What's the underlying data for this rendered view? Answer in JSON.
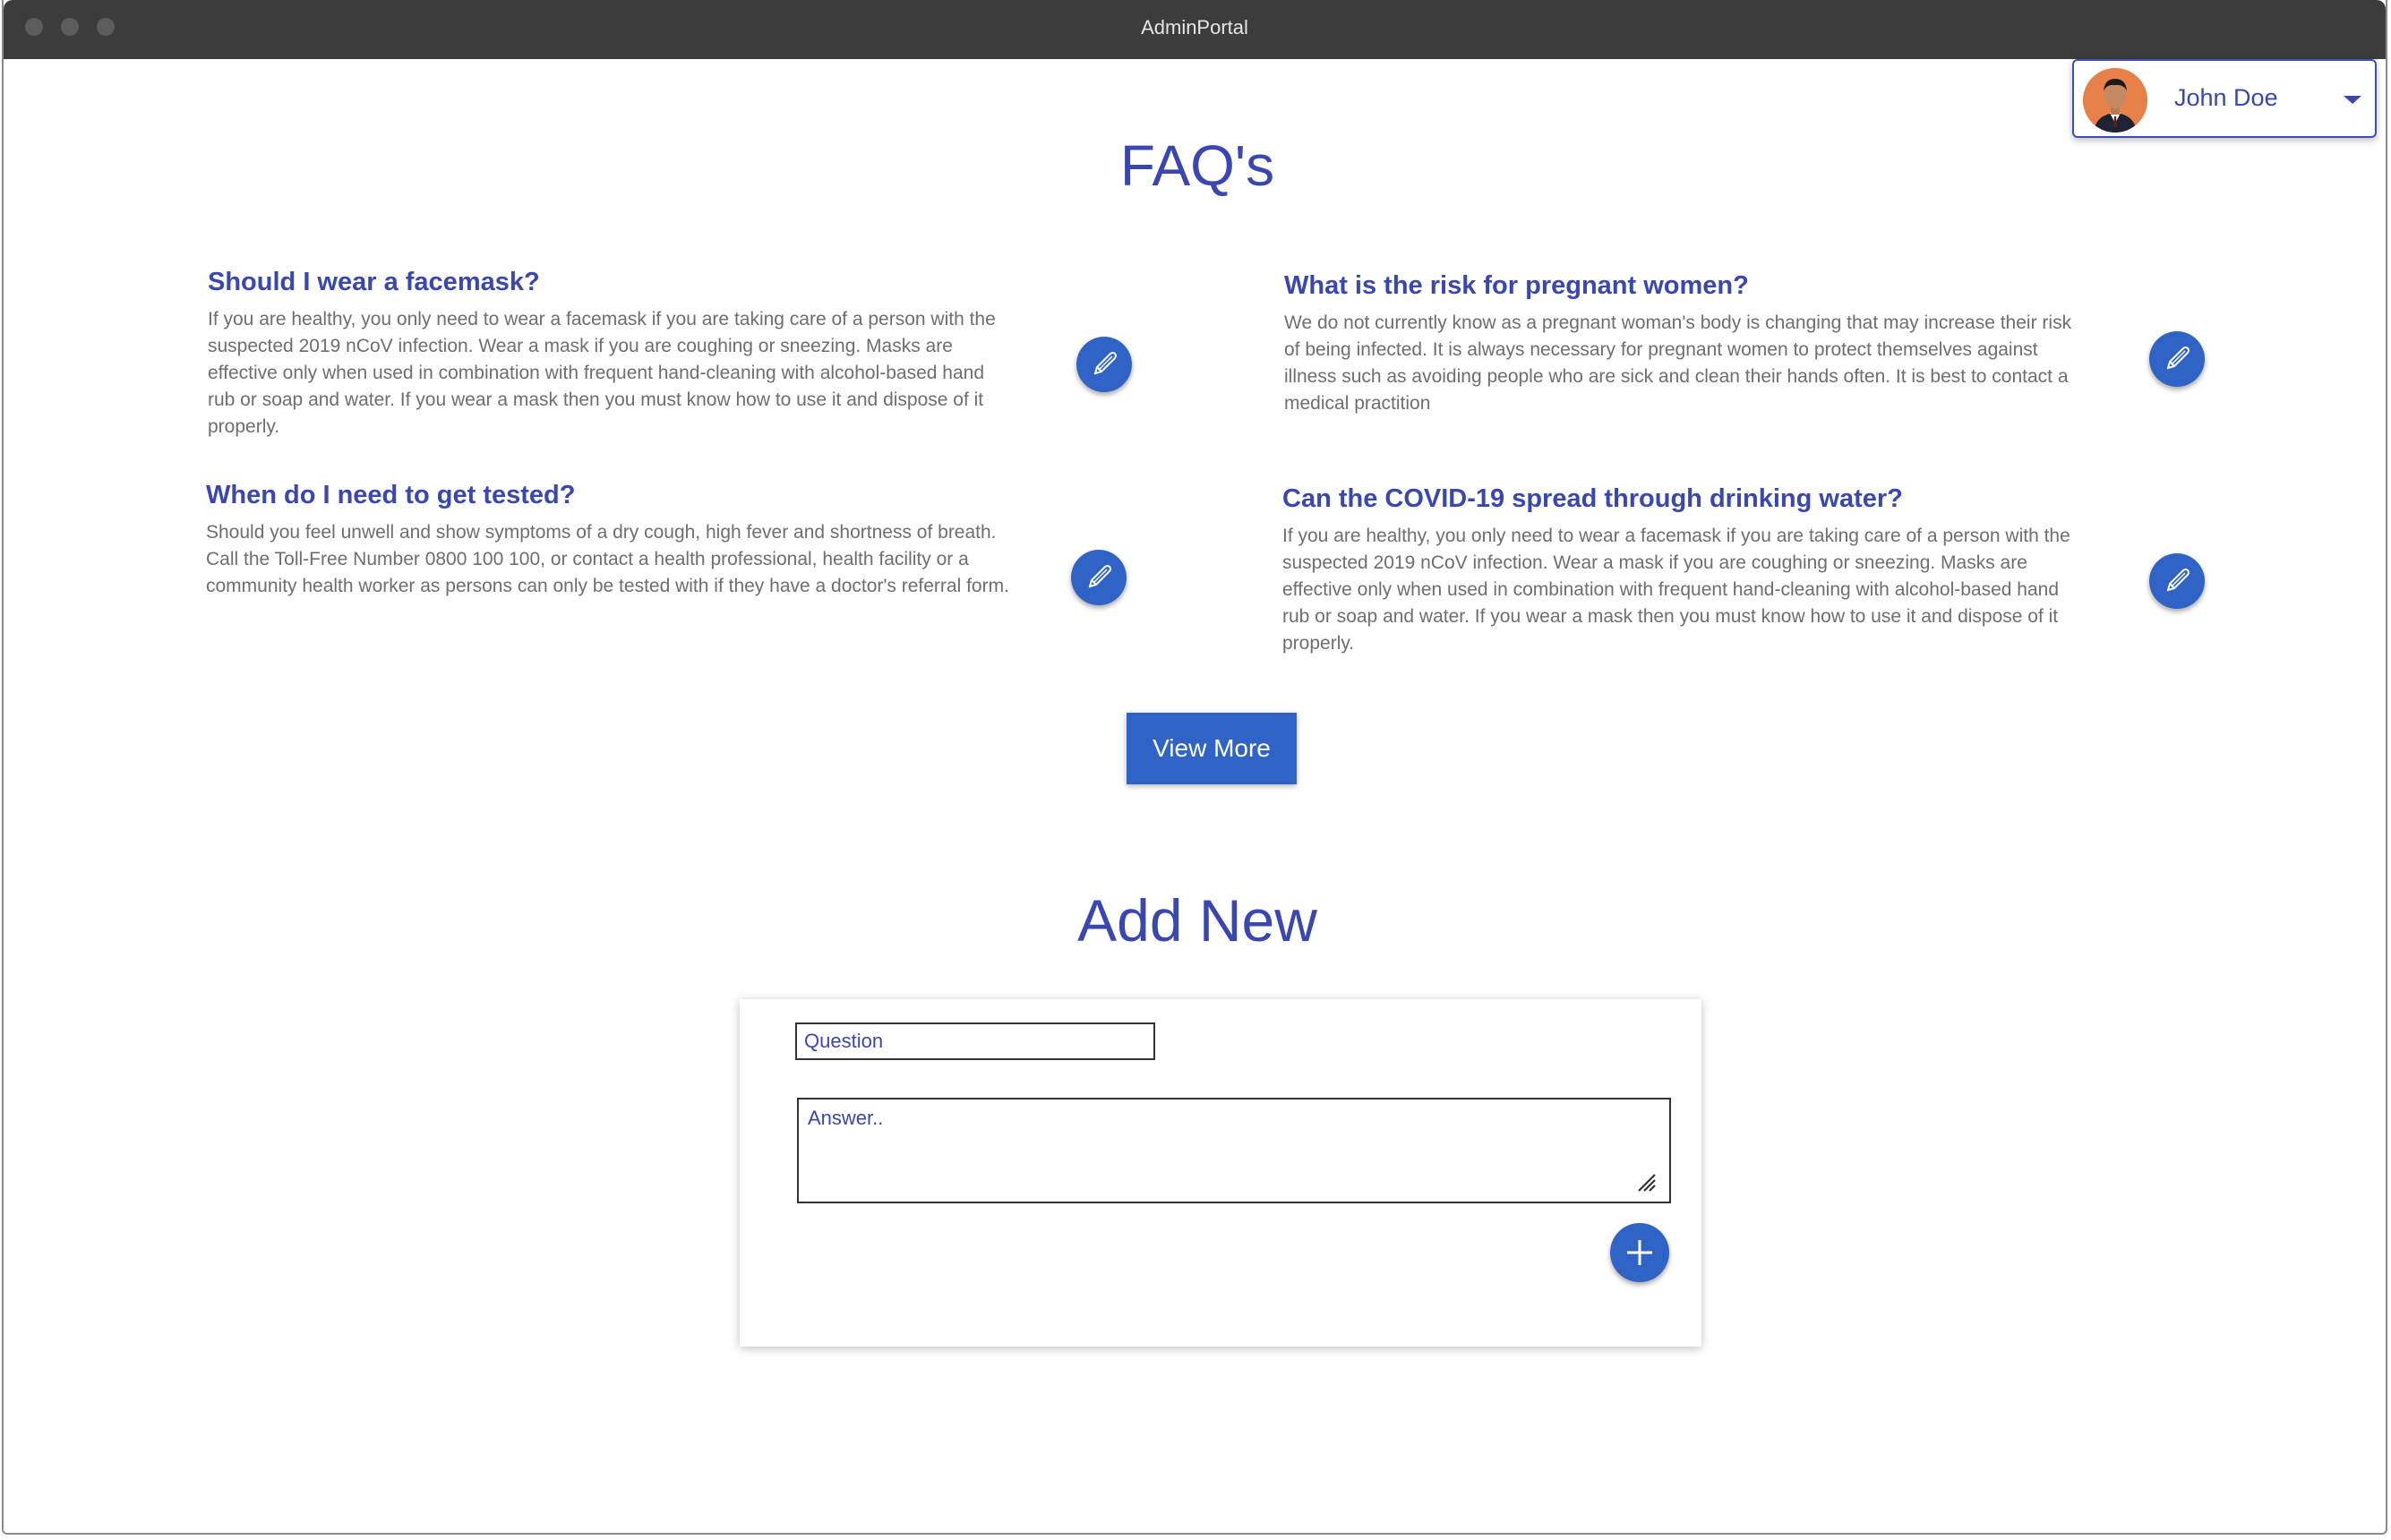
{
  "window": {
    "title": "AdminPortal"
  },
  "user": {
    "name": "John Doe"
  },
  "faq_section": {
    "title": "FAQ's",
    "items": [
      {
        "question": "Should I wear a facemask?",
        "answer": "If you are healthy, you only need to wear a facemask if you are taking care of a person with the suspected 2019 nCoV infection. Wear a mask if you are coughing or sneezing. Masks are effective only when used in combination with frequent hand-cleaning with alcohol-based hand rub or soap and water. If you wear a mask then you must know how to use it and dispose of it properly."
      },
      {
        "question": "What is the risk for pregnant women?",
        "answer": "We do not currently know as a pregnant woman's body is changing that may increase their risk of being infected. It is always necessary for pregnant women to protect themselves against illness such as avoiding people who are sick and clean their hands often. It is best to contact a medical practition"
      },
      {
        "question": "When do I need to get tested?",
        "answer": "Should you feel unwell and show symptoms of a dry cough, high fever and shortness of breath. Call the Toll-Free Number 0800 100 100, or contact a health professional, health facility or a community health worker as persons can only be tested with if they have a doctor's referral form."
      },
      {
        "question": "Can the COVID-19 spread through drinking water?",
        "answer": "If you are healthy, you only need to wear a facemask if you are taking care of a person with the suspected 2019 nCoV infection. Wear a mask if you are coughing or sneezing. Masks are effective only when used in combination with frequent hand-cleaning with alcohol-based hand rub or soap and water. If you wear a mask then you must know how to use it and dispose of it properly."
      }
    ],
    "view_more_label": "View More"
  },
  "add_new": {
    "title": "Add New",
    "question_placeholder": "Question",
    "answer_placeholder": "Answer.."
  },
  "colors": {
    "accent": "#2f63c5",
    "heading": "#3a47b0",
    "body_text": "#6e6e6e",
    "avatar_bg": "#e8804a"
  },
  "icons": {
    "edit": "pen-icon",
    "add": "plus-icon",
    "menu": "chevron-down-icon"
  }
}
